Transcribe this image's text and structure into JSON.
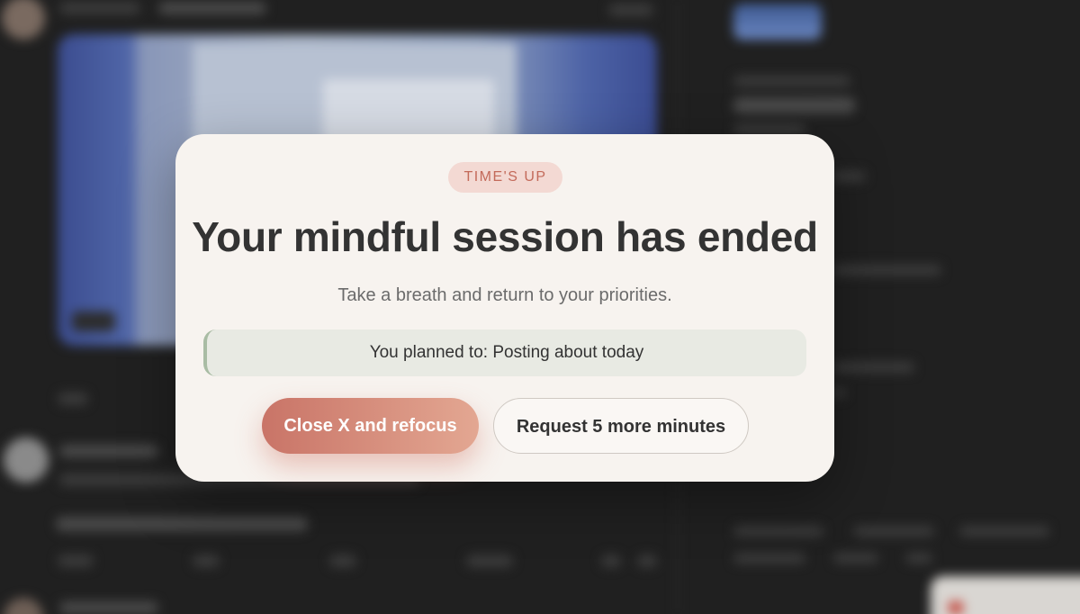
{
  "modal": {
    "badge": "TIME'S UP",
    "title": "Your mindful session has ended",
    "subtitle": "Take a breath and return to your priorities.",
    "plan_text": "You planned to: Posting about today",
    "primary_button": "Close X and refocus",
    "secondary_button": "Request 5 more minutes"
  },
  "colors": {
    "accent": "#c97467",
    "badge_bg": "#f3d9d3",
    "plan_bg": "#e8eae3",
    "plan_border": "#a9bca4",
    "modal_bg": "#f7f3ef",
    "backdrop": "#202020"
  },
  "icons": {
    "background_notification": "red-square-icon"
  }
}
